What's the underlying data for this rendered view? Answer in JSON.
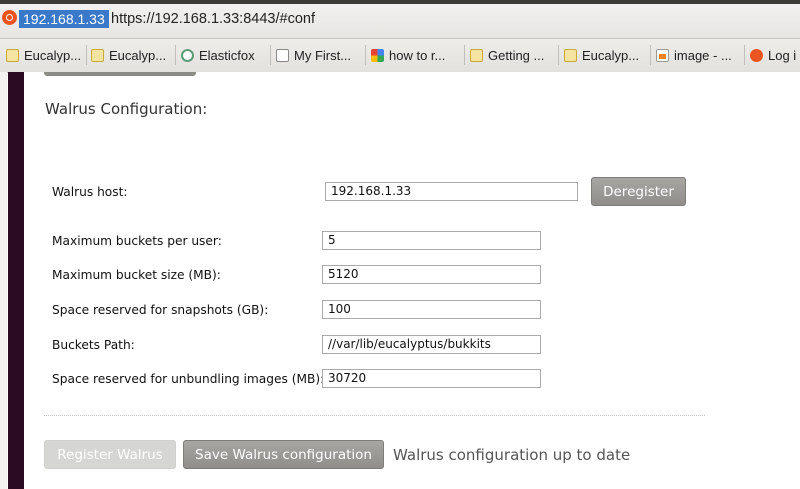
{
  "address_bar": {
    "identity_label": "192.168.1.33",
    "url": "https://192.168.1.33:8443/#conf"
  },
  "bookmarks": [
    {
      "label": "Eucalyp...",
      "icon": "eucalyptus-icon"
    },
    {
      "label": "Eucalyp...",
      "icon": "eucalyptus-icon"
    },
    {
      "label": "Elasticfox",
      "icon": "elasticfox-icon"
    },
    {
      "label": "My First...",
      "icon": "page-icon"
    },
    {
      "label": "how to r...",
      "icon": "google-icon"
    },
    {
      "label": "Getting ...",
      "icon": "eucalyptus-icon"
    },
    {
      "label": "Eucalyp...",
      "icon": "eucalyptus-icon"
    },
    {
      "label": "image - ...",
      "icon": "stackoverflow-icon"
    },
    {
      "label": "Log i",
      "icon": "ubuntu-icon"
    }
  ],
  "walrus": {
    "section_title": "Walrus Configuration:",
    "host_label": "Walrus host:",
    "host_value": "192.168.1.33",
    "deregister_label": "Deregister",
    "fields": [
      {
        "label": "Maximum buckets per user:",
        "value": "5"
      },
      {
        "label": "Maximum bucket size (MB):",
        "value": "5120"
      },
      {
        "label": "Space reserved for snapshots (GB):",
        "value": "100"
      },
      {
        "label": "Buckets Path:",
        "value": "//var/lib/eucalyptus/bukkits"
      },
      {
        "label": "Space reserved for unbundling images (MB):",
        "value": "30720"
      }
    ],
    "register_label": "Register Walrus",
    "save_label": "Save Walrus configuration",
    "status": "Walrus configuration up to date"
  },
  "colors": {
    "identity_chip": "#3a78c9",
    "side_bar": "#2b0a23",
    "button": "#9a9995"
  }
}
